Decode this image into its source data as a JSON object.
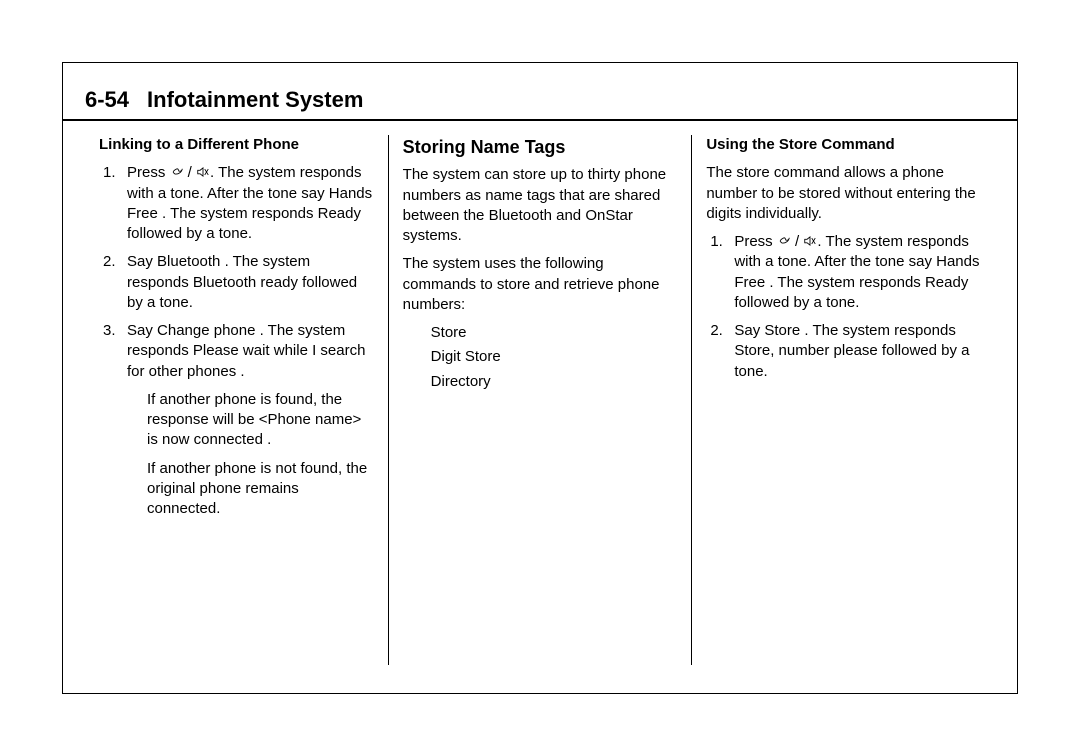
{
  "header": {
    "pageNumber": "6-54",
    "title": "Infotainment System"
  },
  "col1": {
    "heading": "Linking to a Different Phone",
    "steps": [
      {
        "n": "1.",
        "pre": "Press ",
        "post": ". The system responds with a tone. After the tone say  Hands Free . The system responds  Ready followed by a tone."
      },
      {
        "n": "2.",
        "text": "Say  Bluetooth . The system responds  Bluetooth ready followed by a tone."
      },
      {
        "n": "3.",
        "text": "Say  Change phone . The system responds  Please wait while I search for other phones ."
      }
    ],
    "sub": [
      "If another phone is found, the response will be  <Phone name> is now connected .",
      "If another phone is not found, the original phone remains connected."
    ]
  },
  "col2": {
    "title": "Storing Name Tags",
    "para1": "The system can store up to thirty phone numbers as name tags that are shared between the Bluetooth and OnStar systems.",
    "para2": "The system uses the following commands to store and retrieve phone numbers:",
    "cmds": [
      "Store",
      "Digit Store",
      "Directory"
    ]
  },
  "col3": {
    "heading": "Using the Store Command",
    "para1": "The store command allows a phone number to be stored without entering the digits individually.",
    "steps": [
      {
        "n": "1.",
        "pre": "Press ",
        "post": ". The system responds with a tone. After the tone say  Hands Free . The system responds  Ready followed by a tone."
      },
      {
        "n": "2.",
        "text": "Say  Store . The system responds  Store, number please followed by a tone."
      }
    ]
  }
}
